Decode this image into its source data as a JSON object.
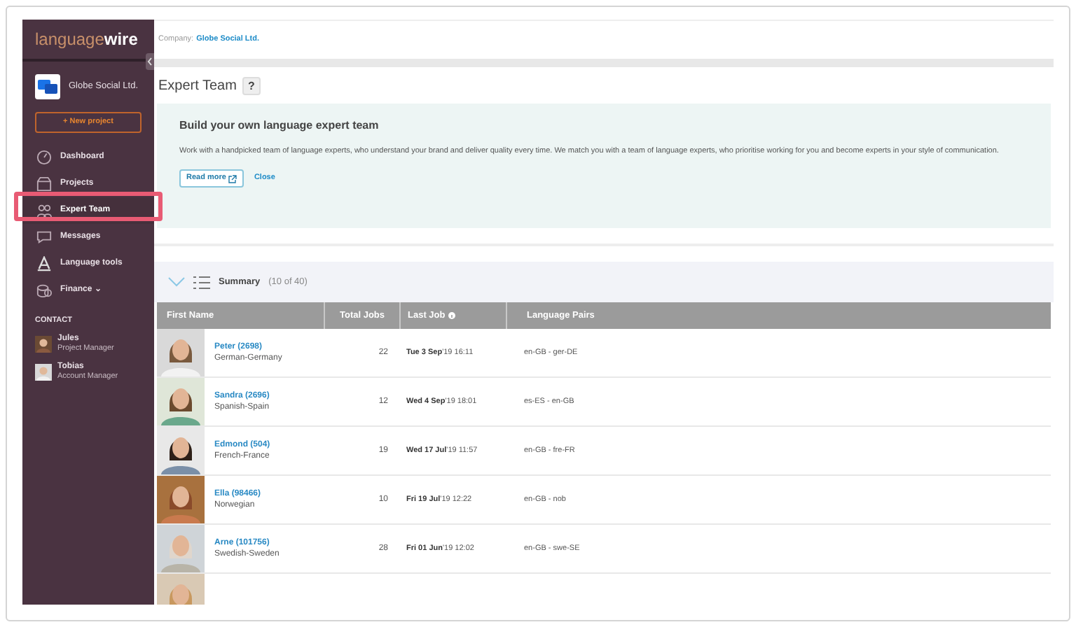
{
  "sidebar": {
    "logo": {
      "light": "language",
      "bold": "wire"
    },
    "company": "Globe Social Ltd.",
    "new_project": "+ New project",
    "items": [
      {
        "label": "Dashboard",
        "selected": false
      },
      {
        "label": "Projects",
        "selected": false
      },
      {
        "label": "Expert Team",
        "selected": true
      },
      {
        "label": "Messages",
        "selected": false
      },
      {
        "label": "Language tools",
        "selected": false
      },
      {
        "label": "Finance ⌄",
        "selected": false
      }
    ],
    "contact_heading": "CONTACT",
    "contacts": [
      {
        "name": "Jules",
        "role": "Project Manager"
      },
      {
        "name": "Tobias",
        "role": "Account Manager"
      }
    ]
  },
  "company_bar": {
    "label": "Company:",
    "value": "Globe Social Ltd."
  },
  "page_title": "Expert Team",
  "help": "?",
  "callout": {
    "title": "Build your own language expert team",
    "body": "Work with a handpicked team of language experts, who understand your brand and deliver quality every time. We match you with a team of language experts, who prioritise working for you and become experts in your style of communication.",
    "read_more": "Read more",
    "close": "Close"
  },
  "summary": {
    "label": "Summary",
    "count": "(10 of 40)"
  },
  "table": {
    "columns": [
      "First Name",
      "Total Jobs",
      "Last Job",
      "Language Pairs"
    ],
    "rows": [
      {
        "kind": "person",
        "name": "Peter (2698)",
        "language": "German-Germany",
        "jobs": "22",
        "date": "Tue 3 Sep",
        "time": "'19 16:11",
        "pair": "en-GB - ger-DE"
      },
      {
        "kind": "person",
        "name": "Sandra (2696)",
        "language": "Spanish-Spain",
        "jobs": "12",
        "date": "Wed 4 Sep",
        "time": "'19 18:01",
        "pair": "es-ES - en-GB"
      },
      {
        "kind": "person",
        "name": "Edmond (504)",
        "language": "French-France",
        "jobs": "19",
        "date": "Wed 17 Jul",
        "time": "'19 11:57",
        "pair": "en-GB - fre-FR"
      },
      {
        "kind": "person",
        "name": "Ella (98466)",
        "language": "Norwegian",
        "jobs": "10",
        "date": "Fri 19 Jul",
        "time": "'19 12:22",
        "pair": "en-GB - nob"
      },
      {
        "kind": "person",
        "name": "Arne (101756)",
        "language": "Swedish-Sweden",
        "jobs": "28",
        "date": "Fri 01 Jun",
        "time": "'19 12:02",
        "pair": "en-GB - swe-SE"
      },
      {
        "kind": "cut"
      }
    ]
  }
}
